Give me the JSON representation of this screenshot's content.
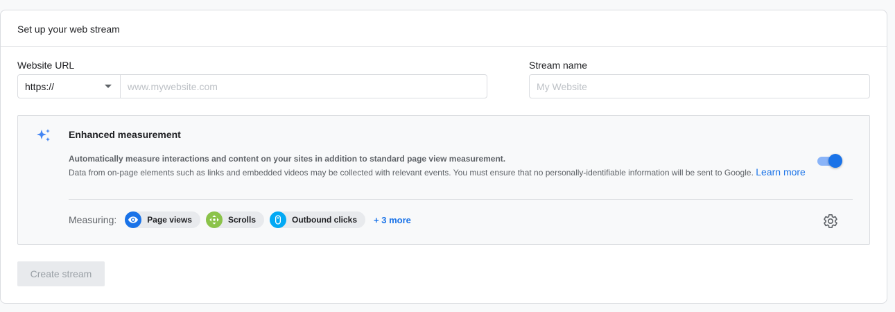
{
  "card": {
    "title": "Set up your web stream"
  },
  "url": {
    "label": "Website URL",
    "protocol": "https://",
    "placeholder": "www.mywebsite.com"
  },
  "stream": {
    "label": "Stream name",
    "placeholder": "My Website"
  },
  "enhanced": {
    "title": "Enhanced measurement",
    "desc_line1": "Automatically measure interactions and content on your sites in addition to standard page view measurement.",
    "desc_line2": "Data from on-page elements such as links and embedded videos may be collected with relevant events. You must ensure that no personally-identifiable information will be sent to Google.",
    "learn_more": "Learn more",
    "toggle_on": true,
    "measuring_label": "Measuring:",
    "chips": [
      {
        "label": "Page views",
        "icon": "eye-icon",
        "color": "#1a73e8"
      },
      {
        "label": "Scrolls",
        "icon": "scroll-icon",
        "color": "#8bc34a"
      },
      {
        "label": "Outbound clicks",
        "icon": "mouse-icon",
        "color": "#03a9f4"
      }
    ],
    "more": "+ 3 more"
  },
  "actions": {
    "create": "Create stream"
  }
}
